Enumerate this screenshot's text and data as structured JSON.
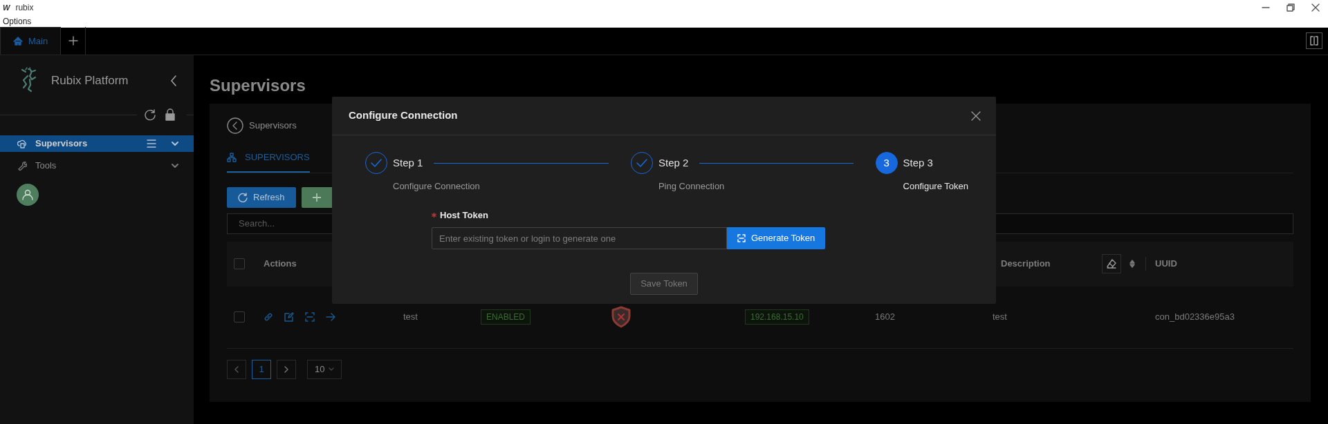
{
  "window": {
    "logo": "W",
    "title": "rubix",
    "menu": [
      "Options"
    ]
  },
  "app_tabs": [
    {
      "label": "Main",
      "selected": true
    }
  ],
  "sidebar": {
    "brand": "Rubix Platform",
    "items": [
      {
        "label": "Supervisors",
        "selected": true,
        "kind": "menu"
      },
      {
        "label": "Tools",
        "selected": false,
        "kind": "plain"
      }
    ]
  },
  "page": {
    "title": "Supervisors",
    "breadcrumb": "Supervisors",
    "tabs": [
      {
        "label": "SUPERVISORS",
        "selected": true
      }
    ],
    "toolbar": [
      {
        "kind": "refresh",
        "label": "Refresh"
      },
      {
        "kind": "add"
      }
    ],
    "search": {
      "placeholder": "Search..."
    },
    "table": {
      "header_checked": false,
      "columns": [
        {
          "label": "Actions"
        },
        {},
        {},
        {},
        {},
        {},
        {
          "label": "Description",
          "filter": true
        },
        {
          "label": "UUID"
        }
      ],
      "rows": [
        {
          "checked": false,
          "cells": [
            {
              "kind": "actions"
            },
            {
              "kind": "text",
              "text": "test"
            },
            {
              "kind": "tag",
              "text": "ENABLED"
            },
            {
              "kind": "shield"
            },
            {
              "kind": "tag",
              "text": "192.168.15.10"
            },
            {
              "kind": "text",
              "text": "1602"
            },
            {
              "kind": "text",
              "text": "test"
            },
            {
              "kind": "text",
              "text": "con_bd02336e95a3"
            }
          ]
        }
      ]
    },
    "pagination": {
      "pages": [
        {
          "label": "1",
          "selected": true
        }
      ],
      "page_size": "10"
    }
  },
  "modal": {
    "title": "Configure Connection",
    "steps": [
      {
        "title": "Step 1",
        "subtitle": "Configure Connection",
        "completed": true,
        "selected": false
      },
      {
        "title": "Step 2",
        "subtitle": "Ping Connection",
        "completed": true,
        "selected": false
      },
      {
        "number": "3",
        "title": "Step 3",
        "subtitle": "Configure Token",
        "completed": false,
        "selected": true
      }
    ],
    "field": {
      "label": "Host Token",
      "required": true,
      "placeholder": "Enter existing token or login to generate one"
    },
    "generate_button": "Generate Token",
    "save_button": {
      "label": "Save Token",
      "disabled": true
    }
  }
}
